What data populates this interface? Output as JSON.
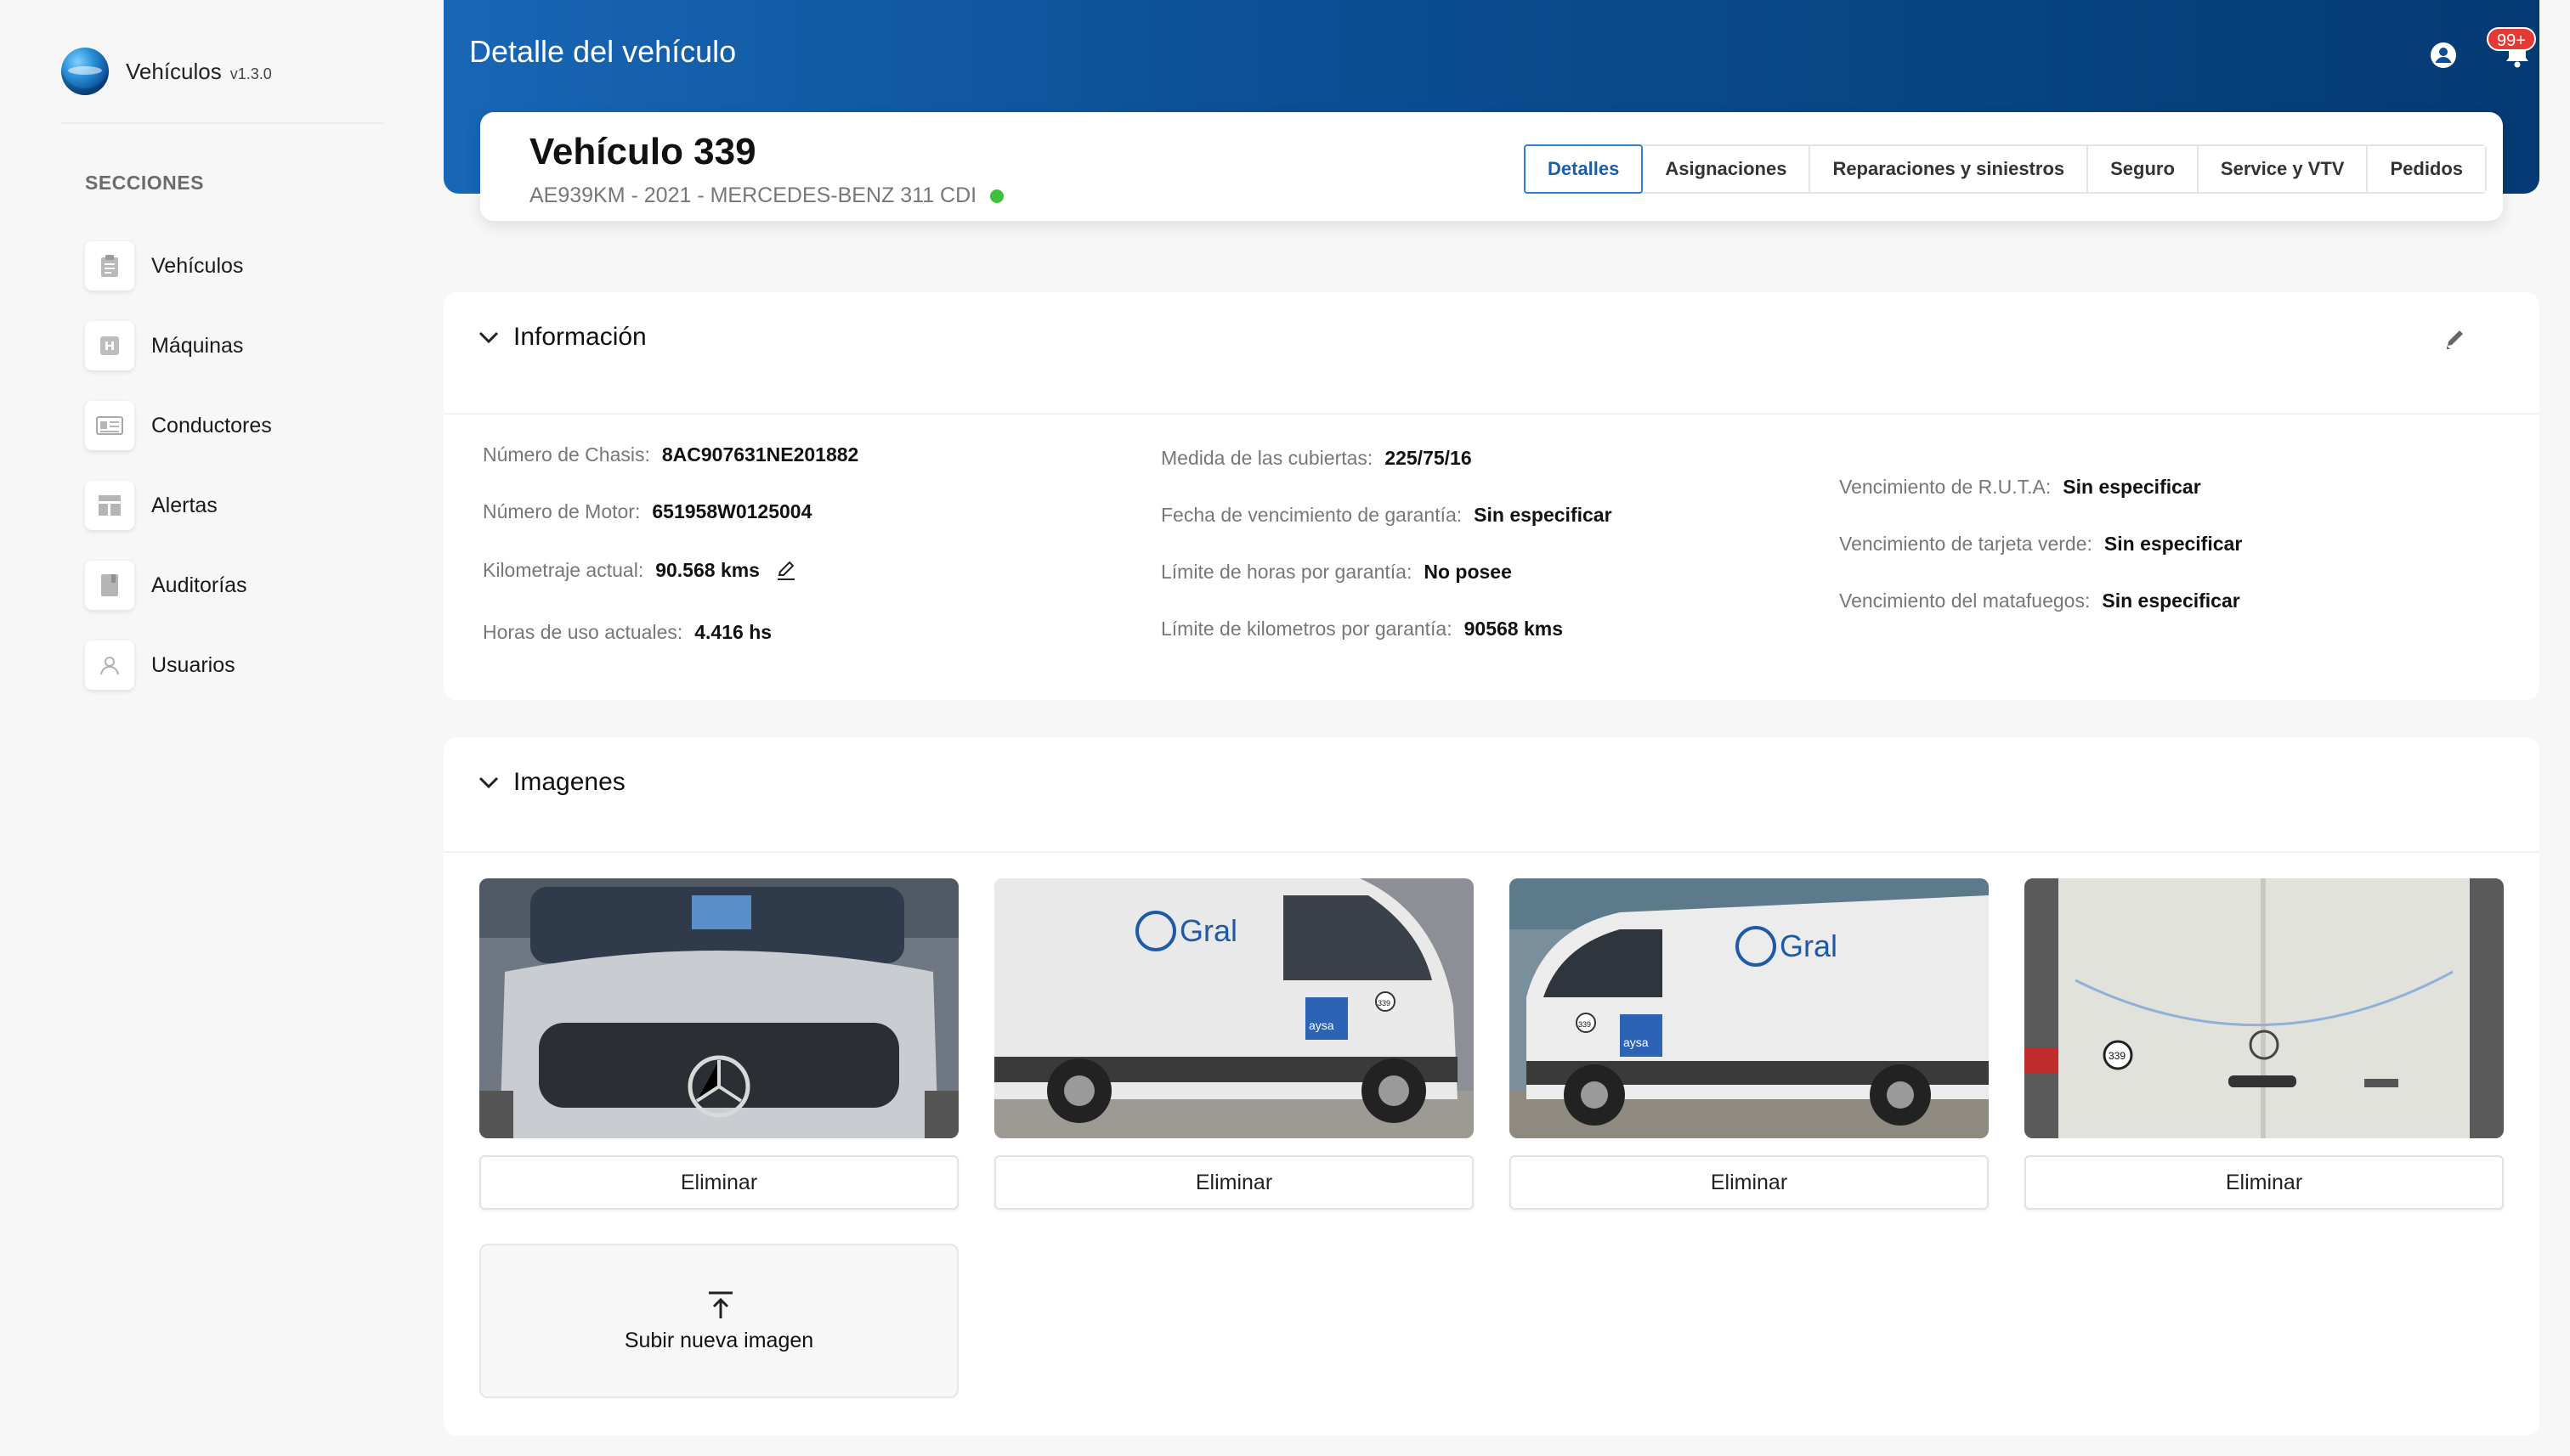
{
  "app": {
    "name": "Vehículos",
    "version": "v1.3.0"
  },
  "sidebar": {
    "section_title": "SECCIONES",
    "items": [
      {
        "label": "Vehículos",
        "icon": "clipboard-icon"
      },
      {
        "label": "Máquinas",
        "icon": "machine-icon"
      },
      {
        "label": "Conductores",
        "icon": "id-card-icon"
      },
      {
        "label": "Alertas",
        "icon": "dashboard-icon"
      },
      {
        "label": "Auditorías",
        "icon": "book-icon"
      },
      {
        "label": "Usuarios",
        "icon": "user-icon"
      }
    ]
  },
  "header": {
    "title": "Detalle del vehículo",
    "notifications_badge": "99+"
  },
  "vehicle": {
    "title": "Vehículo 339",
    "subtitle": "AE939KM - 2021 - MERCEDES-BENZ 311 CDI",
    "status_color": "#3cc13b"
  },
  "tabs": [
    {
      "label": "Detalles",
      "active": true
    },
    {
      "label": "Asignaciones"
    },
    {
      "label": "Reparaciones y siniestros"
    },
    {
      "label": "Seguro"
    },
    {
      "label": "Service y VTV"
    },
    {
      "label": "Pedidos"
    }
  ],
  "info": {
    "title": "Información",
    "col1": [
      {
        "key": "Número de Chasis",
        "value": "8AC907631NE201882"
      },
      {
        "key": "Número de Motor",
        "value": "651958W0125004"
      },
      {
        "key": "Kilometraje actual",
        "value": "90.568 kms"
      },
      {
        "key": "Horas de uso actuales",
        "value": "4.416 hs"
      }
    ],
    "col2": [
      {
        "key": "Medida de las cubiertas",
        "value": "225/75/16"
      },
      {
        "key": "Fecha de vencimiento de garantía",
        "value": "Sin especificar"
      },
      {
        "key": "Límite de horas por garantía",
        "value": "No posee"
      },
      {
        "key": "Límite de kilometros por garantía",
        "value": "90568 kms"
      }
    ],
    "col3": [
      {
        "key": "Vencimiento de R.U.T.A",
        "value": "Sin especificar"
      },
      {
        "key": "Vencimiento de tarjeta verde",
        "value": "Sin especificar"
      },
      {
        "key": "Vencimiento del matafuegos",
        "value": "Sin especificar"
      }
    ]
  },
  "images": {
    "title": "Imagenes",
    "items": [
      {
        "delete_label": "Eliminar"
      },
      {
        "delete_label": "Eliminar",
        "logo_text": "Gral",
        "tag_text": "aysa",
        "number": "339"
      },
      {
        "delete_label": "Eliminar",
        "logo_text": "Gral",
        "tag_text": "aysa",
        "number": "339"
      },
      {
        "delete_label": "Eliminar",
        "number": "339"
      }
    ],
    "upload_label": "Subir nueva imagen"
  },
  "colors": {
    "accent": "#1a5faa",
    "header_start": "#1866b5",
    "header_end": "#053a74",
    "badge": "#e53935"
  }
}
